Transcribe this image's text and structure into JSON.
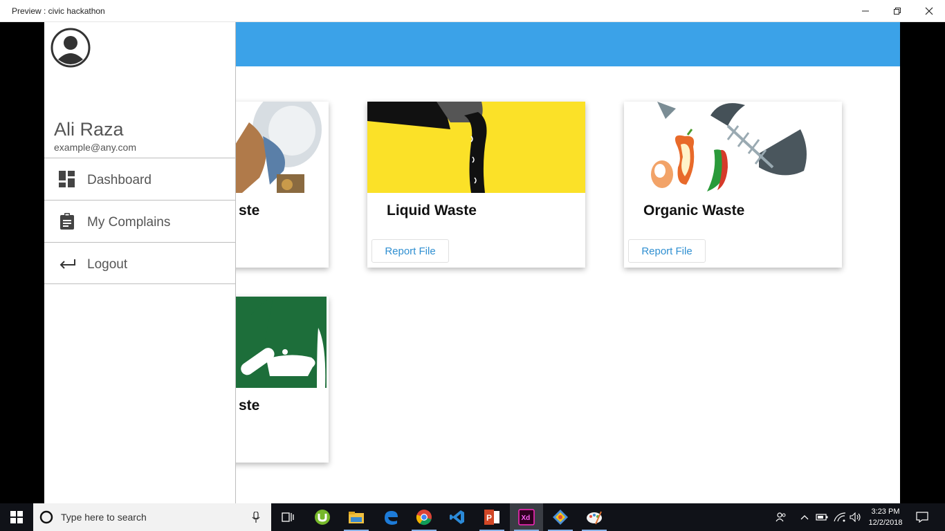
{
  "window": {
    "title": "Preview : civic hackathon"
  },
  "cards": [
    {
      "title": "ste",
      "button": ""
    },
    {
      "title": "Liquid Waste",
      "button": "Report File"
    },
    {
      "title": "Organic Waste",
      "button": "Report File"
    },
    {
      "title": "ste",
      "button": ""
    }
  ],
  "drawer": {
    "user_name": "Ali Raza",
    "user_email": "example@any.com",
    "menu": [
      {
        "label": "Dashboard",
        "icon": "dashboard-icon"
      },
      {
        "label": "My Complains",
        "icon": "clipboard-icon"
      },
      {
        "label": "Logout",
        "icon": "logout-arrow-icon"
      }
    ]
  },
  "taskbar": {
    "search_placeholder": "Type here to search",
    "time": "3:23 PM",
    "date": "12/2/2018"
  },
  "colors": {
    "appbar": "#3ba2e8",
    "button_text": "#2f8fd1",
    "taskbar": "#101218"
  }
}
